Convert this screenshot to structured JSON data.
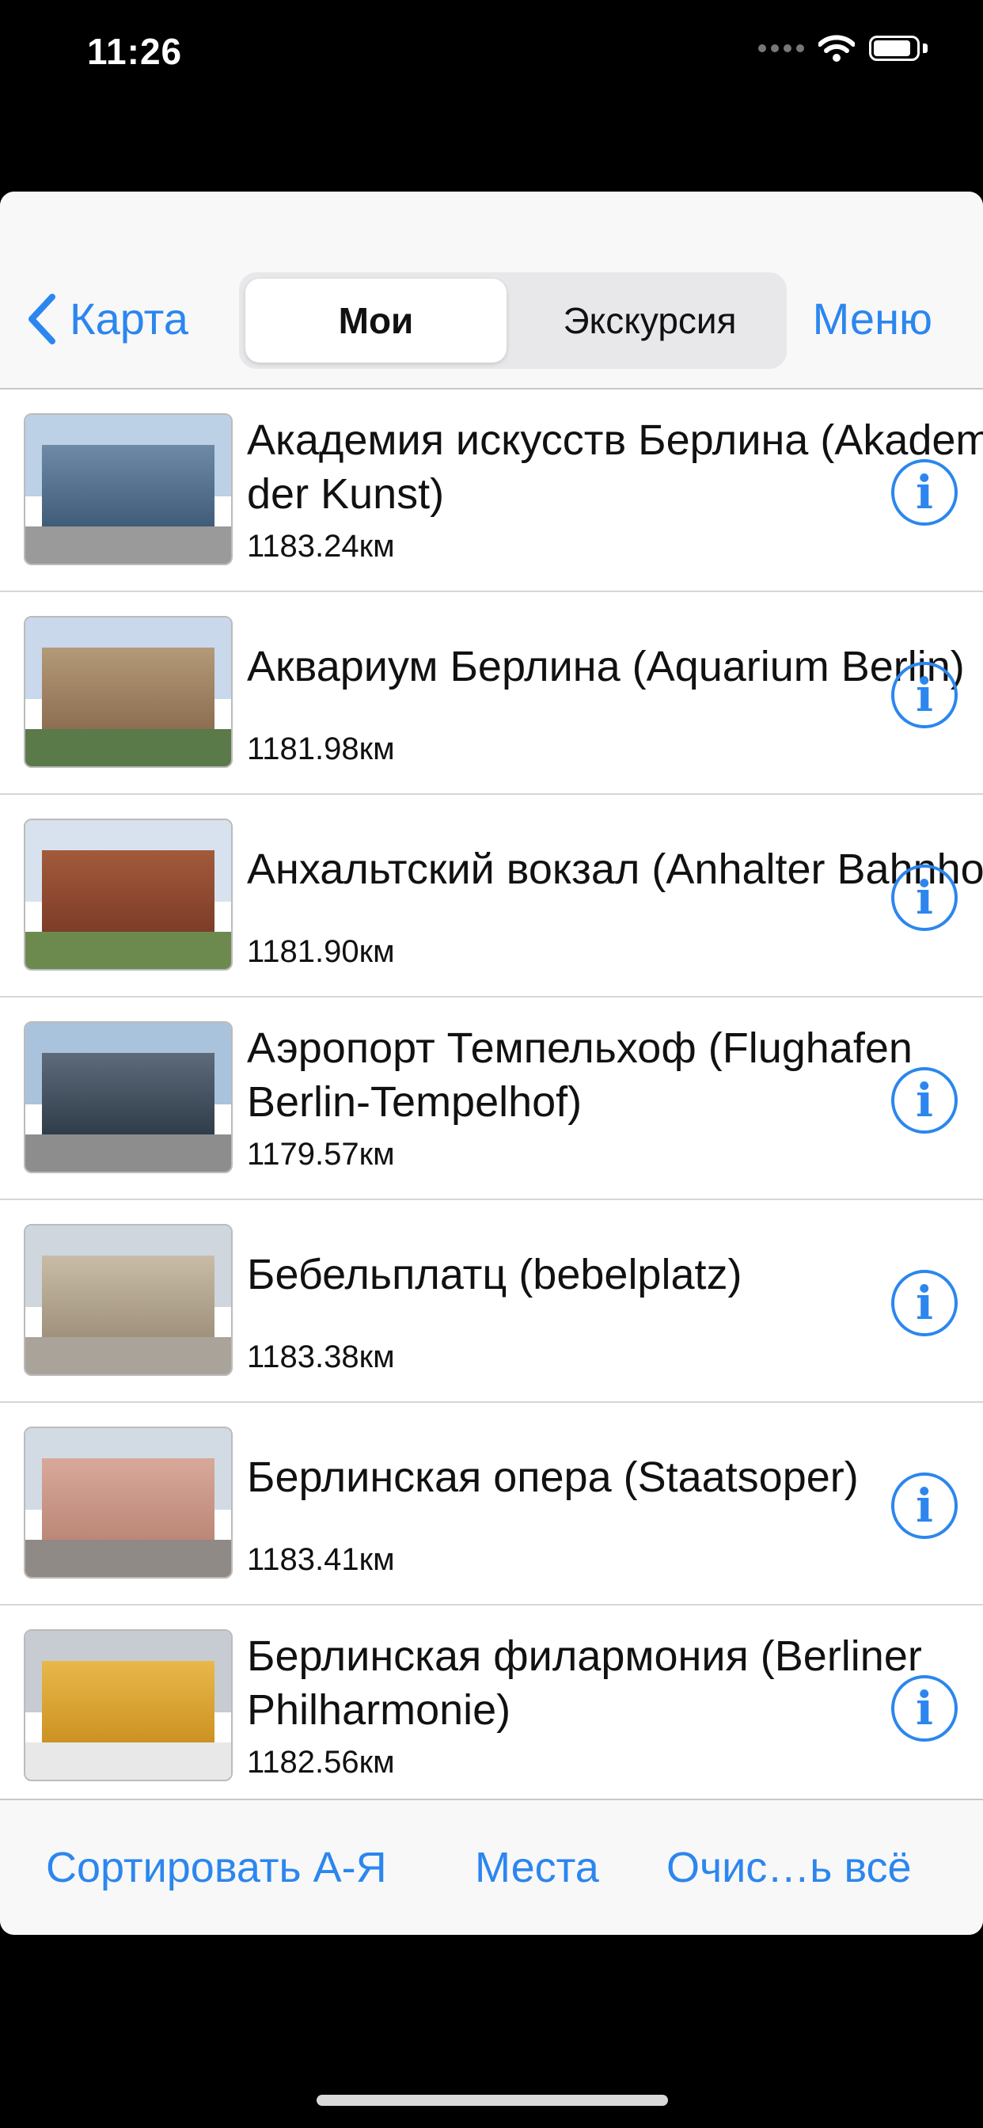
{
  "status_bar": {
    "time": "11:26"
  },
  "nav": {
    "back_label": "Карта",
    "segments": [
      "Мои",
      "Экскурсия"
    ],
    "menu_label": "Меню"
  },
  "places": [
    {
      "title_line1": "Академия искусств Берлина (Akademie",
      "title_line2": "der Kunst)",
      "distance": "1183.24км"
    },
    {
      "title_line1": "Аквариум Берлина (Aquarium Berlin)",
      "title_line2": "",
      "distance": "1181.98км"
    },
    {
      "title_line1": "Анхальтский вокзал (Anhalter Bahnhof)",
      "title_line2": "",
      "distance": "1181.90км"
    },
    {
      "title_line1": "Аэропорт Темпельхоф (Flughafen",
      "title_line2": "Berlin-Tempelhof)",
      "distance": "1179.57км"
    },
    {
      "title_line1": "Бебельплатц (bebelplatz)",
      "title_line2": "",
      "distance": "1183.38км"
    },
    {
      "title_line1": "Берлинская опера (Staatsoper)",
      "title_line2": "",
      "distance": "1183.41км"
    },
    {
      "title_line1": "Берлинская филармония (Berliner",
      "title_line2": "Philharmonie)",
      "distance": "1182.56км"
    }
  ],
  "info_icon_glyph": "i",
  "toolbar": {
    "sort_label": "Сортировать А-Я",
    "places_label": "Места",
    "clear_label": "Очис…ь всё"
  },
  "colors": {
    "accent": "#2c86ee"
  }
}
